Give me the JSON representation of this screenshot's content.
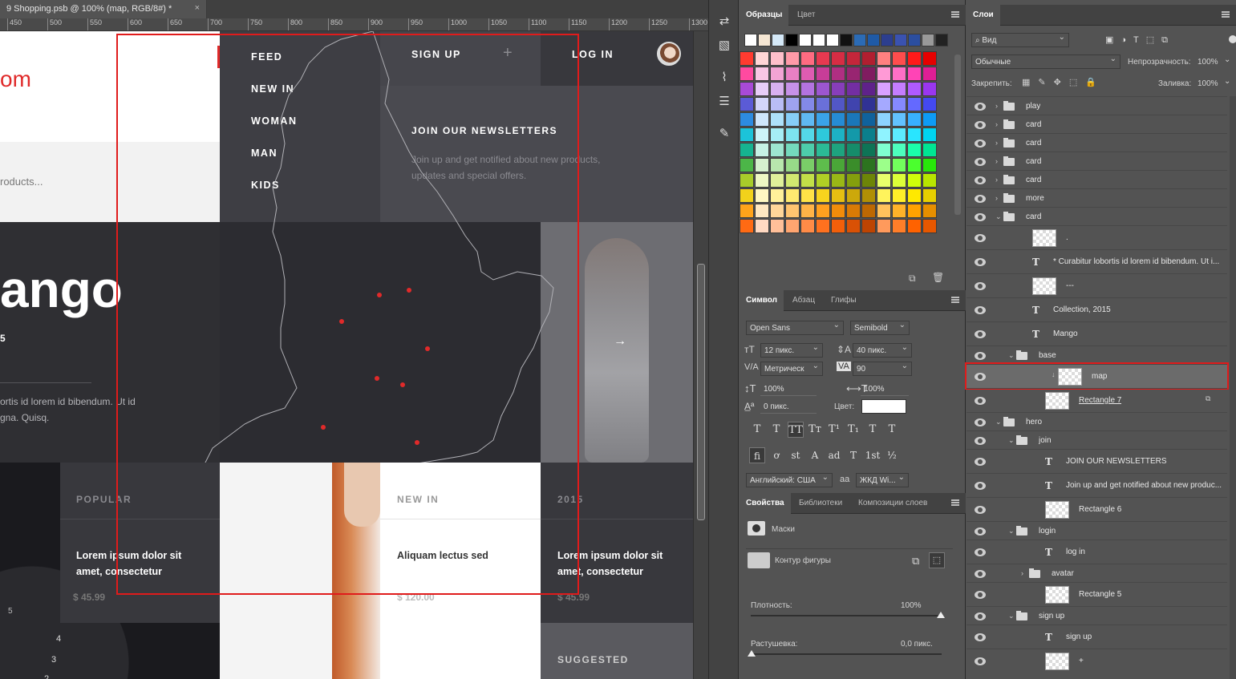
{
  "document": {
    "tab_title": "9 Shopping.psb @ 100% (map, RGB/8#) *",
    "ruler_ticks": [
      "450",
      "500",
      "550",
      "600",
      "650",
      "700",
      "750",
      "800",
      "850",
      "900",
      "950",
      "1000",
      "1050",
      "1100",
      "1150",
      "1200",
      "1250",
      "1300"
    ]
  },
  "design": {
    "logo_fragment": "om",
    "search_placeholder": "roducts...",
    "nav": [
      "FEED",
      "NEW IN",
      "WOMAN",
      "MAN",
      "KIDS"
    ],
    "sign_up": "SIGN UP",
    "plus": "+",
    "log_in": "LOG IN",
    "newsletter_title": "JOIN OUR NEWSLETTERS",
    "newsletter_text_1": "Join up and get notified about new products,",
    "newsletter_text_2": "updates and special offers.",
    "hero_title": "ango",
    "hero_small": "5",
    "hero_body_1": "ortis id lorem id bibendum. Ut id",
    "hero_body_2": "gna. Quisq.",
    "next_arrow": "→",
    "cards": [
      {
        "tag": "POPULAR",
        "title_1": "Lorem ipsum dolor sit",
        "title_2": "amet, consectetur",
        "price": "$ 45.99"
      },
      {
        "tag": "NEW IN",
        "title_1": "Aliquam lectus sed",
        "title_2": "",
        "price": "$ 120.00"
      },
      {
        "tag": "2015",
        "title_1": "Lorem ipsum dolor sit",
        "title_2": "amet, consectetur",
        "price": "$ 45.99"
      }
    ],
    "suggested": "SUGGESTED",
    "watch_digits": [
      "5",
      "4",
      "3",
      "2"
    ],
    "colors": {
      "accent": "#e02a2a",
      "selection": "#e01b1b"
    }
  },
  "swatches_panel": {
    "tabs": [
      "Образцы",
      "Цвет"
    ],
    "top_row": [
      "#ffffff",
      "#f5e6d3",
      "#d4e8f7",
      "#000000",
      "#ffffff",
      "#ffffff",
      "#ffffff",
      "#111111",
      "#2b6bb5",
      "#1f5aa6",
      "#2c3e8f",
      "#3a52b0",
      "#2b4ea0",
      "#999999",
      "#222222"
    ],
    "grid_rows": [
      [
        "#ff3b30",
        "#ffd6d6",
        "#ffc0cb",
        "#ff9aa8",
        "#ff6b81",
        "#e63950",
        "#d62d44",
        "#c4263a",
        "#b01f30",
        "#ff8080",
        "#ff4d4d",
        "#ff1a1a",
        "#e60000"
      ],
      [
        "#ff4aa0",
        "#f9c6e4",
        "#f2a4d4",
        "#e880c3",
        "#df5cb2",
        "#c83d98",
        "#b02f82",
        "#982571",
        "#801c60",
        "#ff9ad6",
        "#ff6fc6",
        "#ff44b6",
        "#e01e94"
      ],
      [
        "#a84ad6",
        "#e7cdf7",
        "#d8b0f0",
        "#c691e8",
        "#b373e0",
        "#9c56cf",
        "#873eba",
        "#732ea2",
        "#5f228a",
        "#d9a1ff",
        "#c57dff",
        "#b05aff",
        "#9a36f0"
      ],
      [
        "#5b5bd6",
        "#d3d6fa",
        "#b9bdf5",
        "#9ea3ef",
        "#8389e8",
        "#6a70d9",
        "#5257c6",
        "#4044ae",
        "#303294",
        "#a5a9ff",
        "#8589ff",
        "#6469ff",
        "#4449f0"
      ],
      [
        "#2d8be0",
        "#cfe6fb",
        "#ade0fa",
        "#86cdf7",
        "#5fb9f2",
        "#3aa3e8",
        "#268cd4",
        "#1a77b9",
        "#10629c",
        "#8cd3ff",
        "#62c2ff",
        "#38b0ff",
        "#0e9bf5"
      ],
      [
        "#1cc3d9",
        "#cdf4f9",
        "#a6edf5",
        "#7de3ef",
        "#54d8e8",
        "#2ec9dc",
        "#1db2c4",
        "#1399a9",
        "#0b7f8c",
        "#8ff3ff",
        "#5cecff",
        "#29e5ff",
        "#00d4f0"
      ],
      [
        "#16b390",
        "#c6f1e4",
        "#9ee6d1",
        "#74dabd",
        "#4dcdab",
        "#2bbb96",
        "#1ea47f",
        "#158c6a",
        "#0e7456",
        "#7fffd0",
        "#4dffbd",
        "#1affaa",
        "#00e693"
      ],
      [
        "#4cb648",
        "#d6f1cf",
        "#b8e6ad",
        "#98da89",
        "#7acd68",
        "#5ebd4c",
        "#4aa638",
        "#3a8d2a",
        "#2c731f",
        "#9cff8a",
        "#72ff5c",
        "#4bff2e",
        "#28e60a"
      ],
      [
        "#a8cc2a",
        "#eef7c4",
        "#e0f09a",
        "#d1e870",
        "#c2df48",
        "#b0cf25",
        "#9ab816",
        "#849f0d",
        "#6d8507",
        "#e8ff6b",
        "#dcff38",
        "#cfff0a",
        "#b8e600"
      ],
      [
        "#f2d21b",
        "#fff8c2",
        "#fff19a",
        "#ffea70",
        "#ffe247",
        "#f7d41e",
        "#e6bf12",
        "#cca80b",
        "#b08f05",
        "#fff35c",
        "#ffee29",
        "#ffe900",
        "#e6cf00"
      ],
      [
        "#ffa31a",
        "#ffe8c2",
        "#ffd699",
        "#ffc470",
        "#ffb347",
        "#ffa01f",
        "#f28c0a",
        "#d97a05",
        "#bd6802",
        "#ffc25c",
        "#ffb229",
        "#ffa200",
        "#e68f00"
      ],
      [
        "#ff6a13",
        "#ffd9c2",
        "#ffbf99",
        "#ffa570",
        "#ff8b47",
        "#ff711f",
        "#f25f0a",
        "#d95105",
        "#bd4402",
        "#ff9a5c",
        "#ff7e29",
        "#ff6200",
        "#e65700"
      ]
    ]
  },
  "character_panel": {
    "tabs": [
      "Символ",
      "Абзац",
      "Глифы"
    ],
    "font_family": "Open Sans",
    "font_style": "Semibold",
    "size": "12 пикс.",
    "leading": "40 пикс.",
    "kerning": "Метрическ",
    "tracking": "90",
    "vscale": "100%",
    "hscale": "100%",
    "baseline": "0 пикс.",
    "color_label": "Цвет:",
    "language": "Английский: США",
    "aa_label": "aа",
    "antialias": "ЖКД Wi...",
    "style_buttons": [
      "T",
      "T",
      "TT",
      "Tт",
      "T¹",
      "T₁",
      "T",
      "T"
    ],
    "ot_buttons": [
      "fi",
      "ơ",
      "st",
      "A",
      "ad",
      "T",
      "1st",
      "½"
    ]
  },
  "properties_panel": {
    "tabs": [
      "Свойства",
      "Библиотеки",
      "Композиции слоев"
    ],
    "masks": "Маски",
    "shape_contour": "Контур фигуры",
    "density_label": "Плотность:",
    "density_value": "100%",
    "feather_label": "Растушевка:",
    "feather_value": "0,0 пикс."
  },
  "layers_panel": {
    "tab": "Слои",
    "filter_kind": "Вид",
    "blend_mode": "Обычные",
    "opacity_label": "Непрозрачность:",
    "opacity_value": "100%",
    "lock_label": "Закрепить:",
    "fill_label": "Заливка:",
    "fill_value": "100%",
    "rows": [
      {
        "name": "play",
        "type": "folder",
        "indent": 0,
        "open": false
      },
      {
        "name": "card",
        "type": "folder",
        "indent": 0,
        "open": false
      },
      {
        "name": "card",
        "type": "folder",
        "indent": 0,
        "open": false
      },
      {
        "name": "card",
        "type": "folder",
        "indent": 0,
        "open": false
      },
      {
        "name": "card",
        "type": "folder",
        "indent": 0,
        "open": false
      },
      {
        "name": "more",
        "type": "folder",
        "indent": 0,
        "open": false
      },
      {
        "name": "card",
        "type": "folder",
        "indent": 0,
        "open": true
      },
      {
        "name": ".",
        "type": "shape",
        "indent": 1
      },
      {
        "name": "* Curabitur lobortis id lorem id bibendum. Ut i...",
        "type": "text",
        "indent": 1
      },
      {
        "name": "---",
        "type": "shape",
        "indent": 1
      },
      {
        "name": "Collection, 2015",
        "type": "text",
        "indent": 1
      },
      {
        "name": "Mango",
        "type": "text",
        "indent": 1
      },
      {
        "name": "base",
        "type": "folder",
        "indent": 1,
        "open": true
      },
      {
        "name": "map",
        "type": "shape",
        "indent": 2,
        "selected": true
      },
      {
        "name": "Rectangle 7",
        "type": "shape",
        "indent": 2
      },
      {
        "name": "hero",
        "type": "folder",
        "indent": 0,
        "open": true
      },
      {
        "name": "join",
        "type": "folder",
        "indent": 1,
        "open": true
      },
      {
        "name": "JOIN OUR NEWSLETTERS",
        "type": "text",
        "indent": 2
      },
      {
        "name": "Join up and get notified about new produc...",
        "type": "text",
        "indent": 2
      },
      {
        "name": "Rectangle 6",
        "type": "shape",
        "indent": 2
      },
      {
        "name": "login",
        "type": "folder",
        "indent": 1,
        "open": true
      },
      {
        "name": "log in",
        "type": "text",
        "indent": 2
      },
      {
        "name": "avatar",
        "type": "folder",
        "indent": 2,
        "open": false
      },
      {
        "name": "Rectangle 5",
        "type": "shape",
        "indent": 2
      },
      {
        "name": "sign up",
        "type": "folder",
        "indent": 1,
        "open": true
      },
      {
        "name": "sign up",
        "type": "text",
        "indent": 2
      },
      {
        "name": "+",
        "type": "shape",
        "indent": 2
      }
    ]
  }
}
